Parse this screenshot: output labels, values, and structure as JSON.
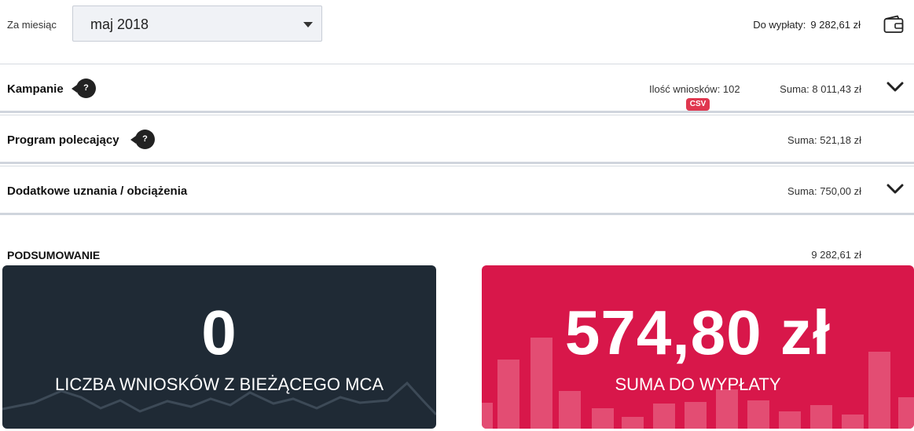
{
  "filter": {
    "month_label": "Za miesiąc",
    "month_value": "maj 2018"
  },
  "payout": {
    "label": "Do wypłaty:",
    "value": "9 282,61 zł",
    "icon": "wallet-icon"
  },
  "sections": {
    "kampanie": {
      "title": "Kampanie",
      "help": "?",
      "count_label": "Ilość wniosków: 102",
      "sum": "Suma: 8 011,43 zł",
      "csv": "CSV"
    },
    "program": {
      "title": "Program polecający",
      "help": "?",
      "sum": "Suma: 521,18 zł"
    },
    "dodatkowe": {
      "title": "Dodatkowe uznania / obciążenia",
      "sum": "Suma: 750,00 zł"
    }
  },
  "summary": {
    "title": "PODSUMOWANIE",
    "value": "9 282,61 zł"
  },
  "cards": {
    "applications": {
      "value": "0",
      "caption": "LICZBA WNIOSKÓW Z BIEŻĄCEGO MCA"
    },
    "payout_sum": {
      "value": "574,80 zł",
      "caption": "SUMA DO WYPŁATY"
    }
  },
  "colors": {
    "dark_card": "#1f2a35",
    "red_card": "#d8174a",
    "csv_badge": "#e0374f"
  }
}
